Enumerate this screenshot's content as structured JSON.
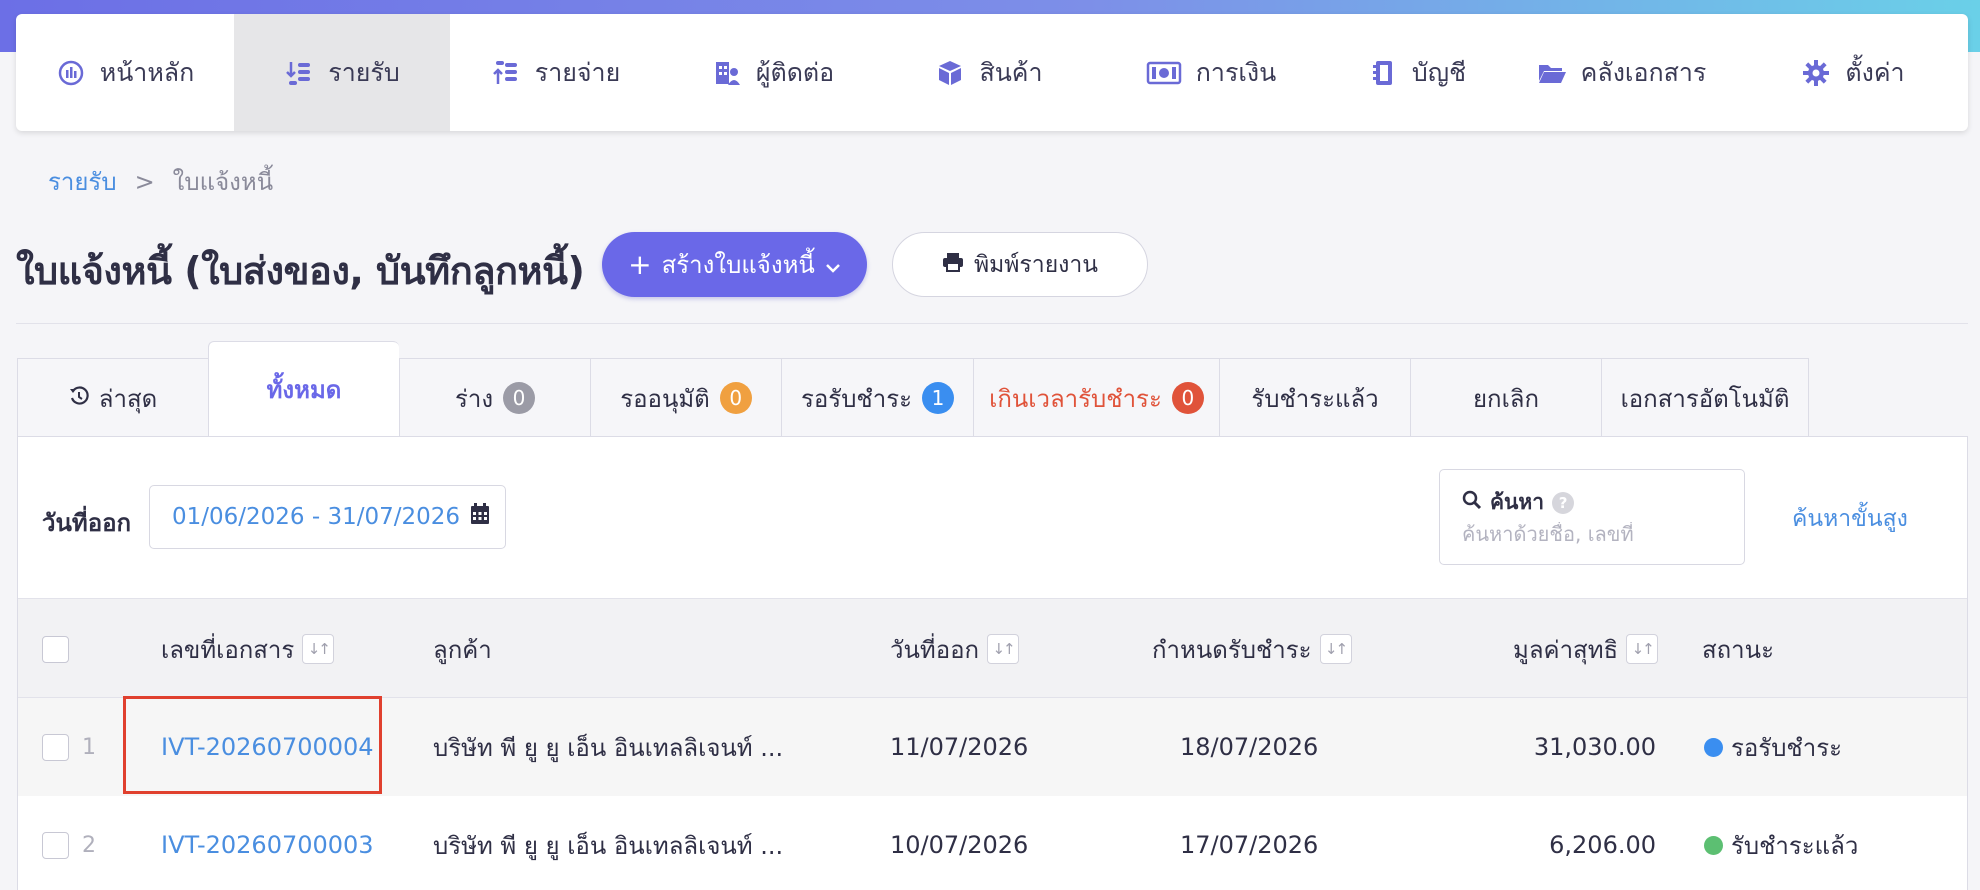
{
  "nav": {
    "items": [
      {
        "label": "หน้าหลัก",
        "icon": "dashboard-icon"
      },
      {
        "label": "รายรับ",
        "icon": "income-icon",
        "active": true
      },
      {
        "label": "รายจ่าย",
        "icon": "expense-icon"
      },
      {
        "label": "ผู้ติดต่อ",
        "icon": "contacts-icon"
      },
      {
        "label": "สินค้า",
        "icon": "product-box-icon"
      },
      {
        "label": "การเงิน",
        "icon": "money-icon"
      },
      {
        "label": "บัญชี",
        "icon": "accounting-book-icon"
      },
      {
        "label": "คลังเอกสาร",
        "icon": "folder-icon"
      },
      {
        "label": "ตั้งค่า",
        "icon": "gear-icon"
      }
    ]
  },
  "breadcrumb": {
    "parent": "รายรับ",
    "separator": ">",
    "current": "ใบแจ้งหนี้"
  },
  "page": {
    "title": "ใบแจ้งหนี้ (ใบส่งของ, บันทึกลูกหนี้)",
    "create_button": "สร้างใบแจ้งหนี้",
    "create_plus": "+",
    "print_button": "พิมพ์รายงาน"
  },
  "tabs": [
    {
      "label": "ล่าสุด"
    },
    {
      "label": "ทั้งหมด",
      "active": true
    },
    {
      "label": "ร่าง",
      "badge": "0",
      "badge_color": "#9b9ba6"
    },
    {
      "label": "รออนุมัติ",
      "badge": "0",
      "badge_color": "#f0a040"
    },
    {
      "label": "รอรับชำระ",
      "badge": "1",
      "badge_color": "#3a8ef0"
    },
    {
      "label": "เกินเวลารับชำระ",
      "badge": "0",
      "badge_color": "#e0533a"
    },
    {
      "label": "รับชำระแล้ว"
    },
    {
      "label": "ยกเลิก"
    },
    {
      "label": "เอกสารอัตโนมัติ"
    }
  ],
  "filters": {
    "date_label": "วันที่ออก",
    "date_range": "01/06/2026 - 31/07/2026",
    "search_title": "ค้นหา",
    "search_placeholder": "ค้นหาด้วยชื่อ, เลขที่",
    "search_value": "",
    "advanced_search": "ค้นหาขั้นสูง"
  },
  "table": {
    "columns": {
      "doc_no": "เลขที่เอกสาร",
      "customer": "ลูกค้า",
      "issue_date": "วันที่ออก",
      "due_date": "กำหนดรับชำระ",
      "net_value": "มูลค่าสุทธิ",
      "status": "สถานะ"
    },
    "rows": [
      {
        "num": "1",
        "doc_no": "IVT-20260700004",
        "customer": "บริษัท พี ยู ยู เอ็น อินเทลลิเจนท์ ...",
        "issue_date": "11/07/2026",
        "due_date": "18/07/2026",
        "net_value": "31,030.00",
        "status": "รอรับชำระ",
        "status_color": "#3a8ef0"
      },
      {
        "num": "2",
        "doc_no": "IVT-20260700003",
        "customer": "บริษัท พี ยู ยู เอ็น อินเทลลิเจนท์ ...",
        "issue_date": "10/07/2026",
        "due_date": "17/07/2026",
        "net_value": "6,206.00",
        "status": "รับชำระแล้ว",
        "status_color": "#5cbf72"
      }
    ]
  }
}
